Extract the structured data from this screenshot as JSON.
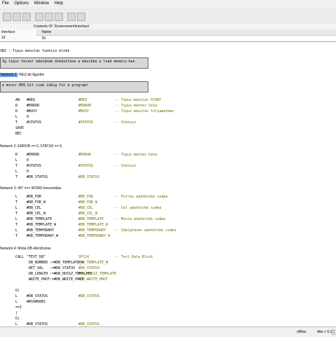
{
  "menu": [
    "File",
    "Options",
    "Window",
    "Help"
  ],
  "contents_label": "Contents Of: 'Environment\\Interface'",
  "interface_panel": {
    "item": "Interface",
    "sub": "19"
  },
  "decl_header": {
    "name_label": "Name",
    "value": "IN"
  },
  "title_line": "SB2 : Tipus másolás funkció blokk",
  "title_box": "Ig tipus teszer adatának átmásolása a másikba a load memory-ban.",
  "net1": {
    "label": "Network 1",
    "title": ": REQ bit figyelés",
    "comment": "e minor REQ bit csak idéig fut a program!"
  },
  "net1_lines": [
    {
      "op": "AN",
      "arg": "#REQ",
      "sym": "#REQ",
      "cm": "-- Tipus másolás START"
    },
    {
      "op": "R",
      "arg": "#ERROR",
      "sym": "#ERROR",
      "cm": "-- Tipus mentés hiba"
    },
    {
      "op": "R",
      "arg": "#BUSY",
      "sym": "#BUSY",
      "cm": "-- Tipus másolás folyamatban"
    },
    {
      "op": "L",
      "arg": "0",
      "sym": "",
      "cm": ""
    },
    {
      "op": "T",
      "arg": "#STATUS",
      "sym": "#STATUS",
      "cm": "-- Státusz"
    },
    {
      "op": "SAVE",
      "arg": "",
      "sym": "",
      "cm": ""
    },
    {
      "op": "BEC",
      "arg": "",
      "sym": "",
      "cm": ""
    }
  ],
  "net2": {
    "label": "Network 2",
    "title": ": ERROR == 0, STATUS == 0,"
  },
  "net2_lines": [
    {
      "op": "R",
      "arg": "#ERROR",
      "sym": "#ERROR",
      "cm": "-- Tipus mentés hiba"
    },
    {
      "op": "L",
      "arg": "0",
      "sym": "",
      "cm": ""
    },
    {
      "op": "T",
      "arg": "#STATUS",
      "sym": "#STATUS",
      "cm": "-- Státusz"
    },
    {
      "op": "L",
      "arg": "0",
      "sym": "",
      "cm": ""
    },
    {
      "op": "T",
      "arg": "#DB_STATUS",
      "sym": "#DB_STATUS",
      "cm": ""
    }
  ],
  "net3": {
    "label": "Network 3",
    "title": ": INT ==> WORD konvertálás"
  },
  "net3_lines": [
    {
      "op": "L",
      "arg": "#DB_FOR",
      "sym": "#DB_FOR",
      "cm": "-- Forrás adatblokk száma"
    },
    {
      "op": "T",
      "arg": "#DB_FOR_W",
      "sym": "#DB_FOR_W",
      "cm": ""
    },
    {
      "op": "L",
      "arg": "#DB_CEL",
      "sym": "#DB_CEL",
      "cm": "-- Cél adatblokk száma"
    },
    {
      "op": "T",
      "arg": "#DB_CEL_W",
      "sym": "#DB_CEL_W",
      "cm": ""
    },
    {
      "op": "L",
      "arg": "#DB_TEMPLATE",
      "sym": "#DB_TEMPLATE",
      "cm": "-- Minta adatblokk száma"
    },
    {
      "op": "T",
      "arg": "#DB_TEMPLATE_W",
      "sym": "#DB_TEMPLATE_W",
      "cm": ""
    },
    {
      "op": "L",
      "arg": "#DB_TEMPORARY",
      "sym": "#DB_TEMPORARY",
      "cm": "-- Ideiglenes adatblokk száma"
    },
    {
      "op": "T",
      "arg": "#DB_TEMPORARY_W",
      "sym": "#DB_TEMPORARY_W",
      "cm": ""
    }
  ],
  "net4": {
    "label": "Network 4",
    "title": ": Minta DB ellenőrzése"
  },
  "net4_lines": [
    {
      "op": "CALL",
      "arg": "\"TEST_DB\"",
      "sym": "SFC24",
      "cm": "-- Test Data Block"
    },
    {
      "op": "",
      "arg": " DB_NUMBER :=#DB_TEMPLATE_W",
      "sym": "#DB_TEMPLATE_W",
      "cm": ""
    },
    {
      "op": "",
      "arg": " RET_VAL   :=#DB_STATUS",
      "sym": "#DB_STATUS",
      "cm": ""
    },
    {
      "op": "",
      "arg": " DB_LENGTH :=#DB_HOSSZ_TEMPLATE",
      "sym": "#DB_HOSSZ_TEMPLATE",
      "cm": ""
    },
    {
      "op": "",
      "arg": " WRITE_PROT:=#DB_WRITE_PROT",
      "sym": "#DB_WRITE_PROT",
      "cm": ""
    },
    {
      "op": "",
      "arg": "",
      "sym": "",
      "cm": ""
    },
    {
      "op": "O(",
      "arg": "",
      "sym": "",
      "cm": ""
    },
    {
      "op": "L",
      "arg": "#DB_STATUS",
      "sym": "#DB_STATUS",
      "cm": ""
    },
    {
      "op": "L",
      "arg": "W#16#80B1",
      "sym": "",
      "cm": ""
    },
    {
      "op": "==I",
      "arg": "",
      "sym": "",
      "cm": ""
    },
    {
      "op": ")",
      "arg": "",
      "sym": "",
      "cm": ""
    },
    {
      "op": "O(",
      "arg": "",
      "sym": "",
      "cm": ""
    },
    {
      "op": "L",
      "arg": "#DB_STATUS",
      "sym": "#DB_STATUS",
      "cm": ""
    }
  ],
  "status": {
    "offline": "offline",
    "abs": "Abs < 5.2"
  }
}
